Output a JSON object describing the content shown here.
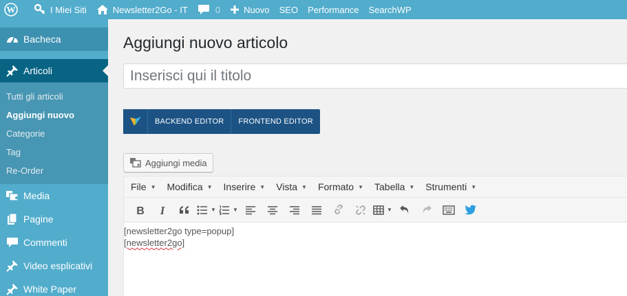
{
  "adminbar": {
    "my_sites": "I Miei Siti",
    "site_name": "Newsletter2Go - IT",
    "comments_count": "0",
    "new_label": "Nuovo",
    "seo": "SEO",
    "performance": "Performance",
    "searchwp": "SearchWP"
  },
  "sidebar": {
    "dashboard": "Bacheca",
    "posts": "Articoli",
    "posts_sub": [
      "Tutti gli articoli",
      "Aggiungi nuovo",
      "Categorie",
      "Tag",
      "Re-Order"
    ],
    "media": "Media",
    "pages": "Pagine",
    "comments": "Commenti",
    "videos": "Video esplicativi",
    "whitepaper": "White Paper"
  },
  "main": {
    "page_title": "Aggiungi nuovo articolo",
    "title_placeholder": "Inserisci qui il titolo",
    "backend_editor": "BACKEND EDITOR",
    "frontend_editor": "FRONTEND EDITOR",
    "add_media": "Aggiungi media"
  },
  "editor": {
    "menu": [
      "File",
      "Modifica",
      "Inserire",
      "Vista",
      "Formato",
      "Tabella",
      "Strumenti"
    ],
    "content_lines": [
      "[newsletter2go  type=popup]",
      "[newsletter2go]"
    ]
  },
  "colors": {
    "adminbar_bg": "#52accc",
    "sidebar_current": "#096484",
    "vc_bar": "#1c5384"
  }
}
